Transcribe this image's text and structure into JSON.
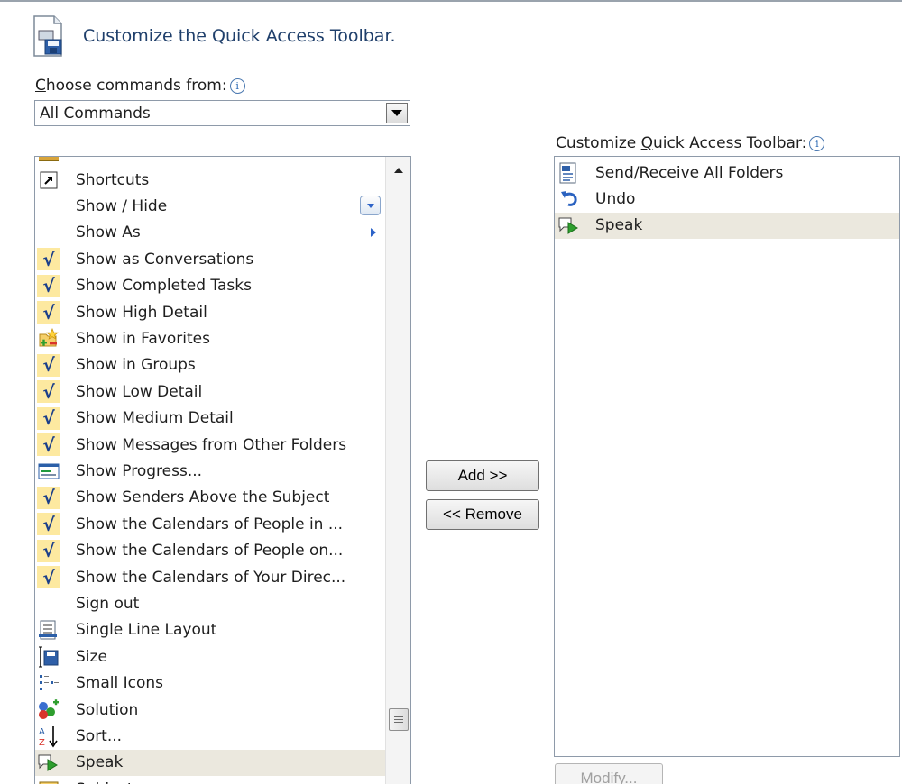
{
  "dialog": {
    "title": "Customize the Quick Access Toolbar.",
    "icon": "toolbar-customize-icon"
  },
  "choose": {
    "label": "Choose commands from:",
    "info_icon": "info-icon",
    "selected": "All Commands"
  },
  "commands": [
    {
      "label": "Shortcuts",
      "icon": "shortcut-arrow-icon",
      "check": false,
      "indicator": ""
    },
    {
      "label": "Show / Hide",
      "icon": "",
      "check": false,
      "indicator": "gallery"
    },
    {
      "label": "Show As",
      "icon": "",
      "check": false,
      "indicator": "submenu"
    },
    {
      "label": "Show as Conversations",
      "icon": "check-icon",
      "check": true,
      "indicator": ""
    },
    {
      "label": "Show Completed Tasks",
      "icon": "check-icon",
      "check": true,
      "indicator": ""
    },
    {
      "label": "Show High Detail",
      "icon": "check-icon",
      "check": true,
      "indicator": ""
    },
    {
      "label": "Show in Favorites",
      "icon": "favorites-folder-icon",
      "check": false,
      "indicator": ""
    },
    {
      "label": "Show in Groups",
      "icon": "check-icon",
      "check": true,
      "indicator": ""
    },
    {
      "label": "Show Low Detail",
      "icon": "check-icon",
      "check": true,
      "indicator": ""
    },
    {
      "label": "Show Medium Detail",
      "icon": "check-icon",
      "check": true,
      "indicator": ""
    },
    {
      "label": "Show Messages from Other Folders",
      "icon": "check-icon",
      "check": true,
      "indicator": ""
    },
    {
      "label": "Show Progress...",
      "icon": "progress-window-icon",
      "check": false,
      "indicator": ""
    },
    {
      "label": "Show Senders Above the Subject",
      "icon": "check-icon",
      "check": true,
      "indicator": ""
    },
    {
      "label": "Show the Calendars of People in ...",
      "icon": "check-icon",
      "check": true,
      "indicator": ""
    },
    {
      "label": "Show the Calendars of People on...",
      "icon": "check-icon",
      "check": true,
      "indicator": ""
    },
    {
      "label": "Show the Calendars of Your Direc...",
      "icon": "check-icon",
      "check": true,
      "indicator": ""
    },
    {
      "label": "Sign out",
      "icon": "",
      "check": false,
      "indicator": ""
    },
    {
      "label": "Single Line Layout",
      "icon": "single-line-layout-icon",
      "check": false,
      "indicator": ""
    },
    {
      "label": "Size",
      "icon": "size-icon",
      "check": false,
      "indicator": ""
    },
    {
      "label": "Small Icons",
      "icon": "small-icons-icon",
      "check": false,
      "indicator": ""
    },
    {
      "label": "Solution",
      "icon": "solution-icon",
      "check": false,
      "indicator": ""
    },
    {
      "label": "Sort...",
      "icon": "sort-az-icon",
      "check": false,
      "indicator": ""
    },
    {
      "label": "Speak",
      "icon": "speak-icon",
      "check": false,
      "indicator": "",
      "selected": true
    },
    {
      "label": "Subject",
      "icon": "subject-icon",
      "check": false,
      "indicator": ""
    }
  ],
  "buttons": {
    "add": "Add >>",
    "remove": "<< Remove",
    "modify": "Modify..."
  },
  "qat": {
    "label": "Customize Quick Access Toolbar:",
    "items": [
      {
        "label": "Send/Receive All Folders",
        "icon": "send-receive-icon"
      },
      {
        "label": "Undo",
        "icon": "undo-icon"
      },
      {
        "label": "Speak",
        "icon": "speak-icon",
        "selected": true
      }
    ]
  },
  "colors": {
    "selection": "#ebe8de",
    "check_bg": "#fde9a0",
    "title_text": "#1f3f6b"
  }
}
